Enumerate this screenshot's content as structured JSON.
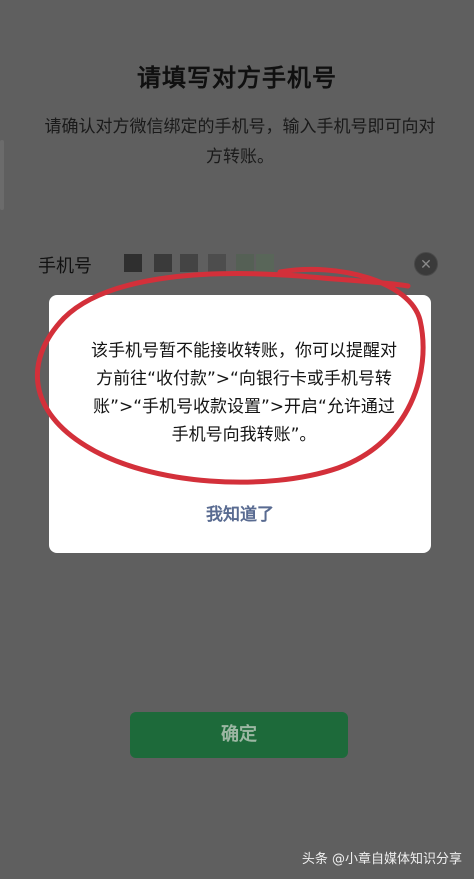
{
  "header": {
    "title": "请填写对方手机号",
    "description": "请确认对方微信绑定的手机号，输入手机号即可向对方转账。"
  },
  "phone_field": {
    "label": "手机号",
    "value_masked": true,
    "clear_icon": "clear-icon"
  },
  "dialog": {
    "message": "该手机号暂不能接收转账，你可以提醒对方前往“收付款”>“向银行卡或手机号转账”>“手机号收款设置”>开启“允许通过手机号向我转账”。",
    "button": "我知道了"
  },
  "confirm_button": "确定",
  "watermark": "头条 @小章自媒体知识分享",
  "colors": {
    "accent_green": "#1d6a3a",
    "dialog_button": "#596b91",
    "annotation_red": "#d3303a"
  }
}
